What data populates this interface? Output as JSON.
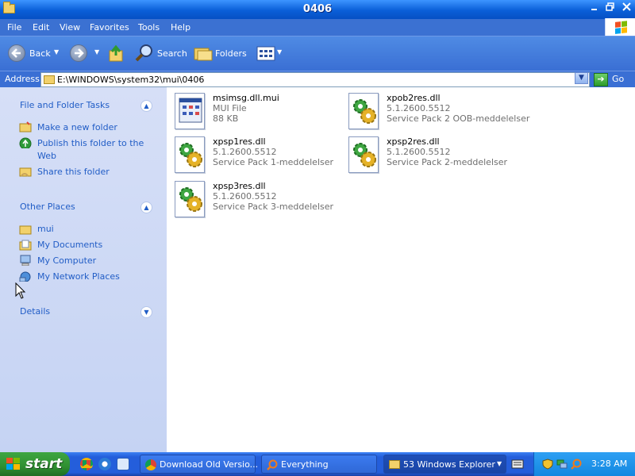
{
  "window": {
    "title": "0406",
    "controls": [
      "minimize",
      "maximize",
      "close"
    ]
  },
  "menu": {
    "items": [
      "File",
      "Edit",
      "View",
      "Favorites",
      "Tools",
      "Help"
    ]
  },
  "toolbar": {
    "back_label": "Back",
    "search_label": "Search",
    "folders_label": "Folders"
  },
  "address": {
    "label": "Address",
    "path": "E:\\WINDOWS\\system32\\mui\\0406",
    "go_label": "Go"
  },
  "tasks": {
    "file_folder_header": "File and Folder Tasks",
    "file_folder_items": [
      "Make a new folder",
      "Publish this folder to the Web",
      "Share this folder"
    ],
    "other_places_header": "Other Places",
    "other_places_items": [
      "mui",
      "My Documents",
      "My Computer",
      "My Network Places"
    ],
    "details_header": "Details"
  },
  "files": [
    {
      "name": "msimsg.dll.mui",
      "line2": "MUI File",
      "line3": "88 KB",
      "icon": "mui-file-icon"
    },
    {
      "name": "xpob2res.dll",
      "line2": "5.1.2600.5512",
      "line3": "Service Pack 2 OOB-meddelelser",
      "icon": "dll-gear-icon"
    },
    {
      "name": "xpsp1res.dll",
      "line2": "5.1.2600.5512",
      "line3": "Service Pack 1-meddelelser",
      "icon": "dll-gear-icon"
    },
    {
      "name": "xpsp2res.dll",
      "line2": "5.1.2600.5512",
      "line3": "Service Pack 2-meddelelser",
      "icon": "dll-gear-icon"
    },
    {
      "name": "xpsp3res.dll",
      "line2": "5.1.2600.5512",
      "line3": "Service Pack 3-meddelelser",
      "icon": "dll-gear-icon"
    }
  ],
  "taskbar": {
    "start_label": "start",
    "buttons": [
      "Download Old Versio...",
      "Everything",
      "53 Windows Explorer"
    ],
    "clock": "3:28 AM"
  },
  "colors": {
    "title_blue": "#0a5fd8",
    "task_panel_link": "#215dc6",
    "start_green": "#3ea641"
  }
}
